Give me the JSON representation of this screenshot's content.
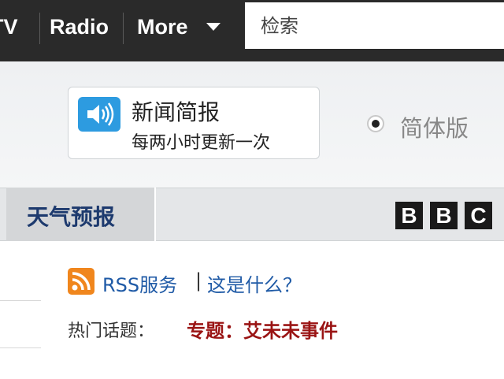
{
  "topnav": {
    "tv": "TV",
    "radio": "Radio",
    "more": "More"
  },
  "search": {
    "placeholder": "检索"
  },
  "bulletin": {
    "title": "新闻简报",
    "subtitle": "每两小时更新一次"
  },
  "version": {
    "label": "简体版",
    "selected": true
  },
  "navbar": {
    "weather_tab": "天气预报",
    "logo_letters": [
      "B",
      "B",
      "C"
    ]
  },
  "rss": {
    "label": "RSS服务",
    "separator": "|",
    "what_link": "这是什么？"
  },
  "hot_topics": {
    "label": "热门话题：",
    "link": "专题：艾未未事件"
  },
  "colors": {
    "topbar": "#2a2a2a",
    "speaker": "#2d9be0",
    "link_blue": "#1f5aa6",
    "hot_red": "#9a1414",
    "weather_text": "#1d3a6e",
    "rss_orange": "#f0861d"
  },
  "icons": {
    "caret": "chevron-down-icon",
    "speaker": "speaker-icon",
    "rss": "rss-icon"
  }
}
